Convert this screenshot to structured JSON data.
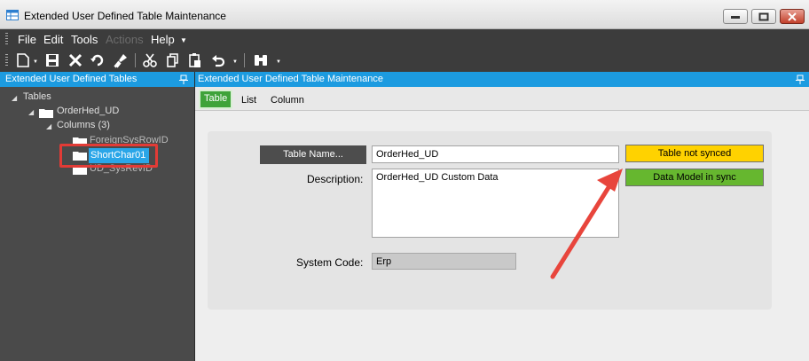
{
  "window": {
    "title": "Extended User Defined Table Maintenance"
  },
  "menu": {
    "items": [
      {
        "label": "File",
        "enabled": true
      },
      {
        "label": "Edit",
        "enabled": true
      },
      {
        "label": "Tools",
        "enabled": true
      },
      {
        "label": "Actions",
        "enabled": false
      },
      {
        "label": "Help",
        "enabled": true
      }
    ]
  },
  "left_panel": {
    "header": "Extended User Defined Tables",
    "tree": {
      "root": "Tables",
      "table": "OrderHed_UD",
      "columns_node": "Columns (3)",
      "columns": [
        "ForeignSysRowID",
        "ShortChar01",
        "UD_SysRevID"
      ],
      "selected": "ShortChar01"
    }
  },
  "right_panel": {
    "header": "Extended User Defined Table Maintenance",
    "tabs": [
      {
        "label": "Table",
        "active": true
      },
      {
        "label": "List",
        "active": false
      },
      {
        "label": "Column",
        "active": false
      }
    ],
    "form": {
      "table_name_button": "Table Name...",
      "table_name_value": "OrderHed_UD",
      "description_label": "Description:",
      "description_value": "OrderHed_UD Custom Data",
      "system_code_label": "System Code:",
      "system_code_value": "Erp",
      "status_table": "Table not synced",
      "status_model": "Data Model in sync"
    }
  },
  "colors": {
    "accent_blue": "#1c9be0",
    "status_yellow": "#ffd200",
    "status_green": "#66b72f",
    "highlight_red": "#e23b36",
    "arrow_red": "#e8453c",
    "tab_green": "#3fa33a"
  }
}
